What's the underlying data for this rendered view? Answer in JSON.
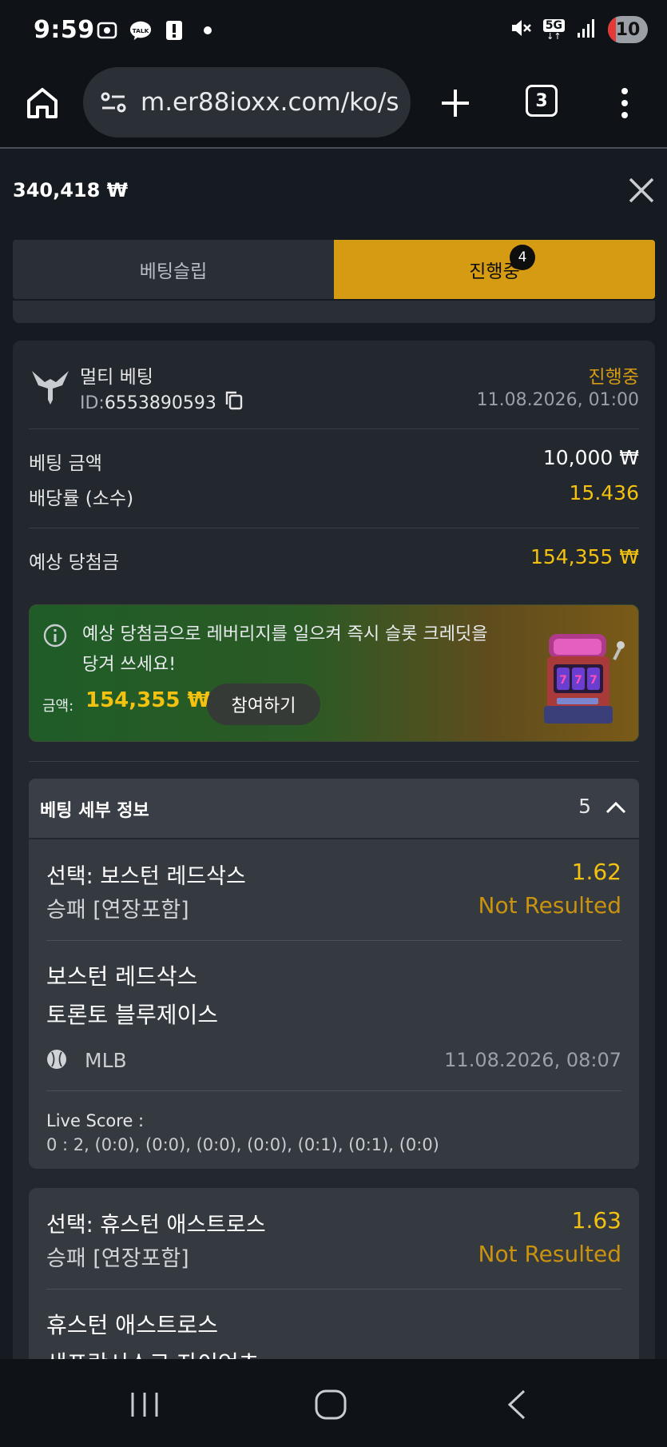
{
  "status_bar": {
    "time": "9:59",
    "network": "5G",
    "battery": "10",
    "icons": [
      "screenshot-icon",
      "kakaotalk-icon",
      "alert-icon",
      "dot-icon",
      "mute-icon",
      "signal-icon"
    ]
  },
  "browser": {
    "url": "m.er88ioxx.com/ko/s",
    "tab_count": "3"
  },
  "header": {
    "balance": "340,418 ₩"
  },
  "tabs": [
    {
      "label": "베팅슬립",
      "active": false
    },
    {
      "label": "진행중",
      "active": true,
      "badge": "4"
    }
  ],
  "bet_summary": {
    "title": "멀티 베팅",
    "id_label": "ID:",
    "id_value": "6553890593",
    "status": "진행중",
    "date": "11.08.2026, 01:00",
    "stake_label": "베팅 금액",
    "stake_value": "10,000 ₩",
    "odds_label": "배당률 (소수)",
    "odds_value": "15.436",
    "payout_label": "예상 당첨금",
    "payout_value": "154,355 ₩"
  },
  "promo": {
    "text": "예상 당첨금으로 레버리지를 일으켜 즉시 슬롯 크레딧을 당겨 쓰세요!",
    "amount_label": "금액:",
    "amount_value": "154,355 ₩",
    "button": "참여하기"
  },
  "details": {
    "title": "베팅 세부 정보",
    "count": "5",
    "bets": [
      {
        "selection": "선택: 보스턴 레드삭스",
        "odds": "1.62",
        "market": "승패 [연장포함]",
        "result": "Not Resulted",
        "team1": "보스턴 레드삭스",
        "team2": "토론토 블루제이스",
        "league": "MLB",
        "date": "11.08.2026, 08:07",
        "live_label": "Live Score :",
        "live_score": "0 : 2, (0:0), (0:0), (0:0), (0:0), (0:1), (0:1), (0:0)"
      },
      {
        "selection": "선택: 휴스턴 애스트로스",
        "odds": "1.63",
        "market": "승패 [연장포함]",
        "result": "Not Resulted",
        "team1": "휴스턴 애스트로스",
        "team2": "샌프란시스코 자이언츠"
      }
    ]
  },
  "colors": {
    "accent": "#d59b12",
    "gold_text": "#f3c10f",
    "background": "#161a21",
    "card": "#23272e"
  }
}
